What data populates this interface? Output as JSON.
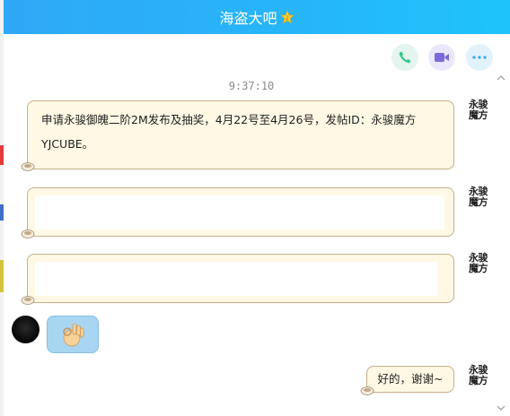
{
  "window": {
    "title": "海盗大吧"
  },
  "toolbar": {
    "icons": [
      "phone-icon",
      "video-icon",
      "more-icon"
    ]
  },
  "chat": {
    "timestamp": "9:37:10",
    "messages": [
      {
        "sender": "永骏魔方",
        "text_line1": "申请永骏御魄二阶2M发布及抽奖，4月22号至4月26号，发帖ID：永骏魔方",
        "text_line2": "YJCUBE。"
      },
      {
        "sender": "永骏魔方"
      },
      {
        "sender": "永骏魔方"
      },
      {
        "sender": "left-user",
        "sticker": "ok-hand-sticker"
      },
      {
        "sender": "永骏魔方",
        "text": "好的，谢谢~"
      }
    ]
  },
  "colors": {
    "title_gradient_start": "#2fa8f6",
    "title_gradient_end": "#1ec3fb",
    "bubble_fill": "#fff8e4",
    "bubble_border": "#c8ad8a",
    "phone_icon": "#3cc68a",
    "video_icon": "#7b6bd8",
    "more_icon": "#2fa8f6"
  }
}
